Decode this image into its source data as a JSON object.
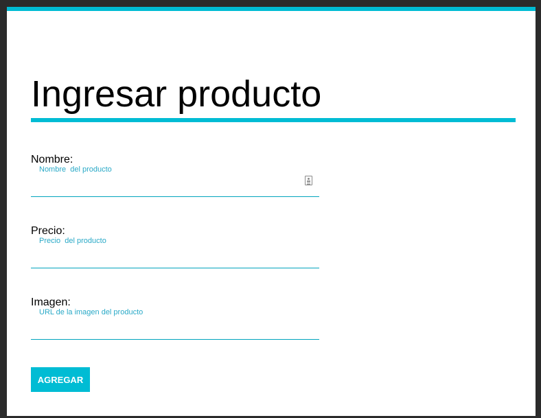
{
  "form": {
    "title": "Ingresar producto",
    "fields": [
      {
        "label": "Nombre:",
        "placeholder": "Nombre  del producto",
        "value": ""
      },
      {
        "label": "Precio:",
        "placeholder": "Precio  del producto",
        "value": ""
      },
      {
        "label": "Imagen:",
        "placeholder": "URL de la imagen del producto",
        "value": ""
      }
    ],
    "submit_label": "AGREGAR"
  },
  "colors": {
    "accent": "#00bcd4",
    "hint": "#29a9c7",
    "background": "#ffffff",
    "frame": "#2b2b2b"
  },
  "icons": {
    "name_field_icon": "contact-card-icon"
  }
}
